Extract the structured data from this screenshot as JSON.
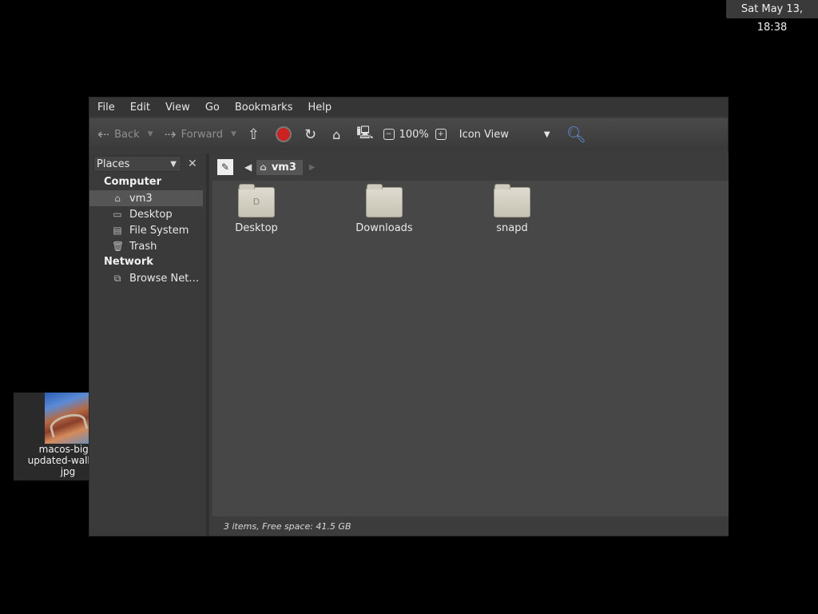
{
  "panel": {
    "clock": "Sat May 13, 18:38"
  },
  "desktop": {
    "icons": [
      {
        "label": "macos-big-s\nupdated-wallpap\njpg"
      }
    ]
  },
  "menubar": {
    "items": [
      "File",
      "Edit",
      "View",
      "Go",
      "Bookmarks",
      "Help"
    ]
  },
  "toolbar": {
    "back_label": "Back",
    "forward_label": "Forward",
    "zoom_level": "100%",
    "view_mode": "Icon View"
  },
  "sidebar": {
    "selector_label": "Places",
    "sections": [
      {
        "title": "Computer",
        "items": [
          "vm3",
          "Desktop",
          "File System",
          "Trash"
        ]
      },
      {
        "title": "Network",
        "items": [
          "Browse Net…"
        ]
      }
    ]
  },
  "location": {
    "current": "vm3"
  },
  "files": [
    {
      "name": "Desktop",
      "emblem": "D"
    },
    {
      "name": "Downloads",
      "emblem": ""
    },
    {
      "name": "snapd",
      "emblem": ""
    }
  ],
  "status": {
    "text": "3 items, Free space: 41.5 GB"
  },
  "colors": {
    "accent": "#5f8fd4",
    "stop": "#cc2222"
  }
}
